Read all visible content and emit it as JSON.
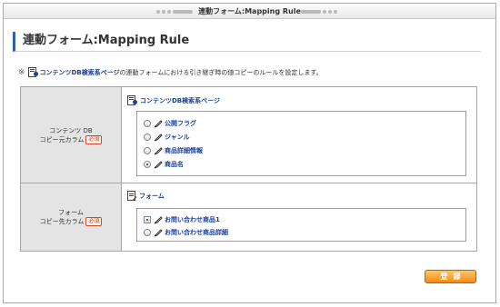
{
  "window": {
    "title": "連動フォーム:Mapping Rule"
  },
  "heading": {
    "title": "連動フォーム:Mapping Rule"
  },
  "description": {
    "asterisk": "※",
    "link_text": "コンテンツDB検索系ページ",
    "text": "の連動フォームにおける引き継ぎ時の値コピーのルールを設定します。"
  },
  "form": {
    "source": {
      "label_line1": "コンテンツ DB",
      "label_line2": "コピー元カラム",
      "required": "必須",
      "section_title": "コンテンツDB検索系ページ",
      "options": [
        {
          "label": "公開フラグ",
          "selected": false
        },
        {
          "label": "ジャンル",
          "selected": false
        },
        {
          "label": "商品詳細情報",
          "selected": false
        },
        {
          "label": "商品名",
          "selected": true
        }
      ]
    },
    "target": {
      "label_line1": "フォーム",
      "label_line2": "コピー先カラム",
      "required": "必須",
      "section_title": "フォーム",
      "options": [
        {
          "label": "お問い合わせ商品1",
          "selected": true
        },
        {
          "label": "お問い合わせ商品詳細",
          "selected": false
        }
      ]
    }
  },
  "submit_label": "登録",
  "colors": {
    "accent": "#2f5fa8",
    "link": "#1a3f9a",
    "submit": "#f08a18",
    "required": "#d04a2a"
  },
  "icons": {
    "db": "database-page-icon",
    "form": "form-icon",
    "tag": "tag-icon"
  }
}
